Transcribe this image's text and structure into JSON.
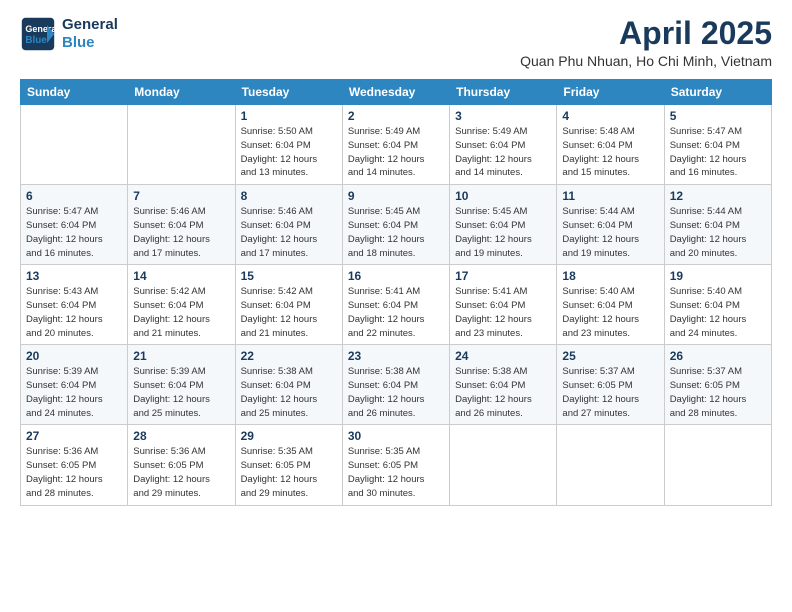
{
  "logo": {
    "line1": "General",
    "line2": "Blue"
  },
  "title": "April 2025",
  "location": "Quan Phu Nhuan, Ho Chi Minh, Vietnam",
  "weekdays": [
    "Sunday",
    "Monday",
    "Tuesday",
    "Wednesday",
    "Thursday",
    "Friday",
    "Saturday"
  ],
  "weeks": [
    [
      {
        "day": "",
        "info": ""
      },
      {
        "day": "",
        "info": ""
      },
      {
        "day": "1",
        "info": "Sunrise: 5:50 AM\nSunset: 6:04 PM\nDaylight: 12 hours\nand 13 minutes."
      },
      {
        "day": "2",
        "info": "Sunrise: 5:49 AM\nSunset: 6:04 PM\nDaylight: 12 hours\nand 14 minutes."
      },
      {
        "day": "3",
        "info": "Sunrise: 5:49 AM\nSunset: 6:04 PM\nDaylight: 12 hours\nand 14 minutes."
      },
      {
        "day": "4",
        "info": "Sunrise: 5:48 AM\nSunset: 6:04 PM\nDaylight: 12 hours\nand 15 minutes."
      },
      {
        "day": "5",
        "info": "Sunrise: 5:47 AM\nSunset: 6:04 PM\nDaylight: 12 hours\nand 16 minutes."
      }
    ],
    [
      {
        "day": "6",
        "info": "Sunrise: 5:47 AM\nSunset: 6:04 PM\nDaylight: 12 hours\nand 16 minutes."
      },
      {
        "day": "7",
        "info": "Sunrise: 5:46 AM\nSunset: 6:04 PM\nDaylight: 12 hours\nand 17 minutes."
      },
      {
        "day": "8",
        "info": "Sunrise: 5:46 AM\nSunset: 6:04 PM\nDaylight: 12 hours\nand 17 minutes."
      },
      {
        "day": "9",
        "info": "Sunrise: 5:45 AM\nSunset: 6:04 PM\nDaylight: 12 hours\nand 18 minutes."
      },
      {
        "day": "10",
        "info": "Sunrise: 5:45 AM\nSunset: 6:04 PM\nDaylight: 12 hours\nand 19 minutes."
      },
      {
        "day": "11",
        "info": "Sunrise: 5:44 AM\nSunset: 6:04 PM\nDaylight: 12 hours\nand 19 minutes."
      },
      {
        "day": "12",
        "info": "Sunrise: 5:44 AM\nSunset: 6:04 PM\nDaylight: 12 hours\nand 20 minutes."
      }
    ],
    [
      {
        "day": "13",
        "info": "Sunrise: 5:43 AM\nSunset: 6:04 PM\nDaylight: 12 hours\nand 20 minutes."
      },
      {
        "day": "14",
        "info": "Sunrise: 5:42 AM\nSunset: 6:04 PM\nDaylight: 12 hours\nand 21 minutes."
      },
      {
        "day": "15",
        "info": "Sunrise: 5:42 AM\nSunset: 6:04 PM\nDaylight: 12 hours\nand 21 minutes."
      },
      {
        "day": "16",
        "info": "Sunrise: 5:41 AM\nSunset: 6:04 PM\nDaylight: 12 hours\nand 22 minutes."
      },
      {
        "day": "17",
        "info": "Sunrise: 5:41 AM\nSunset: 6:04 PM\nDaylight: 12 hours\nand 23 minutes."
      },
      {
        "day": "18",
        "info": "Sunrise: 5:40 AM\nSunset: 6:04 PM\nDaylight: 12 hours\nand 23 minutes."
      },
      {
        "day": "19",
        "info": "Sunrise: 5:40 AM\nSunset: 6:04 PM\nDaylight: 12 hours\nand 24 minutes."
      }
    ],
    [
      {
        "day": "20",
        "info": "Sunrise: 5:39 AM\nSunset: 6:04 PM\nDaylight: 12 hours\nand 24 minutes."
      },
      {
        "day": "21",
        "info": "Sunrise: 5:39 AM\nSunset: 6:04 PM\nDaylight: 12 hours\nand 25 minutes."
      },
      {
        "day": "22",
        "info": "Sunrise: 5:38 AM\nSunset: 6:04 PM\nDaylight: 12 hours\nand 25 minutes."
      },
      {
        "day": "23",
        "info": "Sunrise: 5:38 AM\nSunset: 6:04 PM\nDaylight: 12 hours\nand 26 minutes."
      },
      {
        "day": "24",
        "info": "Sunrise: 5:38 AM\nSunset: 6:04 PM\nDaylight: 12 hours\nand 26 minutes."
      },
      {
        "day": "25",
        "info": "Sunrise: 5:37 AM\nSunset: 6:05 PM\nDaylight: 12 hours\nand 27 minutes."
      },
      {
        "day": "26",
        "info": "Sunrise: 5:37 AM\nSunset: 6:05 PM\nDaylight: 12 hours\nand 28 minutes."
      }
    ],
    [
      {
        "day": "27",
        "info": "Sunrise: 5:36 AM\nSunset: 6:05 PM\nDaylight: 12 hours\nand 28 minutes."
      },
      {
        "day": "28",
        "info": "Sunrise: 5:36 AM\nSunset: 6:05 PM\nDaylight: 12 hours\nand 29 minutes."
      },
      {
        "day": "29",
        "info": "Sunrise: 5:35 AM\nSunset: 6:05 PM\nDaylight: 12 hours\nand 29 minutes."
      },
      {
        "day": "30",
        "info": "Sunrise: 5:35 AM\nSunset: 6:05 PM\nDaylight: 12 hours\nand 30 minutes."
      },
      {
        "day": "",
        "info": ""
      },
      {
        "day": "",
        "info": ""
      },
      {
        "day": "",
        "info": ""
      }
    ]
  ]
}
